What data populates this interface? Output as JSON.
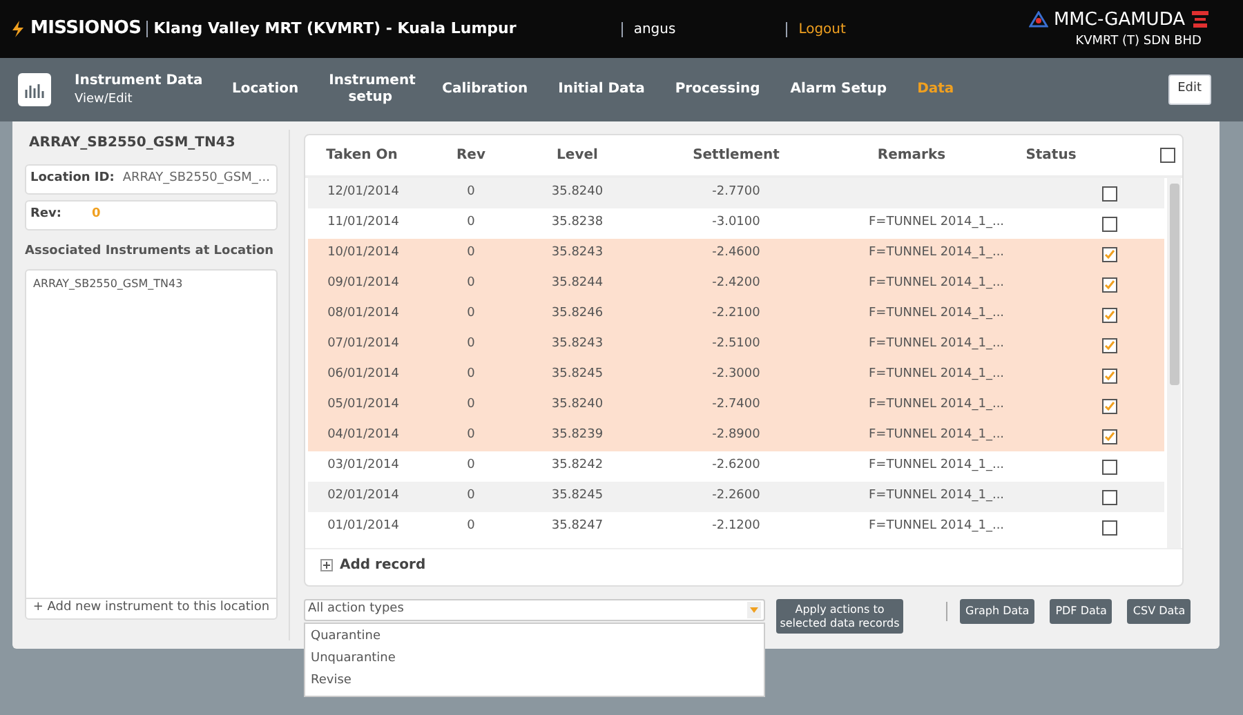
{
  "header": {
    "brand": "MISSIONOS",
    "project": "Klang Valley MRT (KVMRT) - Kuala Lumpur",
    "user": "angus",
    "logout": "Logout",
    "company": "MMC-GAMUDA",
    "company_sub": "KVMRT (T) SDN BHD"
  },
  "nav": {
    "title": "Instrument Data",
    "subtitle": "View/Edit",
    "tabs": [
      {
        "label": "Location",
        "selected": false
      },
      {
        "label": "Instrument setup",
        "selected": false
      },
      {
        "label": "Calibration",
        "selected": false
      },
      {
        "label": "Initial Data",
        "selected": false
      },
      {
        "label": "Processing",
        "selected": false
      },
      {
        "label": "Alarm Setup",
        "selected": false
      },
      {
        "label": "Data",
        "selected": true
      }
    ],
    "edit_button": "Edit"
  },
  "sidebar": {
    "title": "ARRAY_SB2550_GSM_TN43",
    "location_label": "Location ID:",
    "location_value": "ARRAY_SB2550_GSM_...",
    "rev_label": "Rev:",
    "rev_value": "0",
    "instruments_heading": "Associated Instruments at Location",
    "instruments": [
      "ARRAY_SB2550_GSM_TN43"
    ],
    "add_instrument": "+ Add new instrument to this location"
  },
  "table": {
    "columns": [
      "Taken On",
      "Rev",
      "Level",
      "Settlement",
      "Remarks",
      "Status"
    ],
    "all_checked": false,
    "rows": [
      {
        "taken_on": "12/01/2014",
        "rev": "0",
        "level": "35.8240",
        "settlement": "-2.7700",
        "remarks": "",
        "selected": false
      },
      {
        "taken_on": "11/01/2014",
        "rev": "0",
        "level": "35.8238",
        "settlement": "-3.0100",
        "remarks": "F=TUNNEL 2014_1_...",
        "selected": false
      },
      {
        "taken_on": "10/01/2014",
        "rev": "0",
        "level": "35.8243",
        "settlement": "-2.4600",
        "remarks": "F=TUNNEL 2014_1_...",
        "selected": true
      },
      {
        "taken_on": "09/01/2014",
        "rev": "0",
        "level": "35.8244",
        "settlement": "-2.4200",
        "remarks": "F=TUNNEL 2014_1_...",
        "selected": true
      },
      {
        "taken_on": "08/01/2014",
        "rev": "0",
        "level": "35.8246",
        "settlement": "-2.2100",
        "remarks": "F=TUNNEL 2014_1_...",
        "selected": true
      },
      {
        "taken_on": "07/01/2014",
        "rev": "0",
        "level": "35.8243",
        "settlement": "-2.5100",
        "remarks": "F=TUNNEL 2014_1_...",
        "selected": true
      },
      {
        "taken_on": "06/01/2014",
        "rev": "0",
        "level": "35.8245",
        "settlement": "-2.3000",
        "remarks": "F=TUNNEL 2014_1_...",
        "selected": true
      },
      {
        "taken_on": "05/01/2014",
        "rev": "0",
        "level": "35.8240",
        "settlement": "-2.7400",
        "remarks": "F=TUNNEL 2014_1_...",
        "selected": true
      },
      {
        "taken_on": "04/01/2014",
        "rev": "0",
        "level": "35.8239",
        "settlement": "-2.8900",
        "remarks": "F=TUNNEL 2014_1_...",
        "selected": true
      },
      {
        "taken_on": "03/01/2014",
        "rev": "0",
        "level": "35.8242",
        "settlement": "-2.6200",
        "remarks": "F=TUNNEL 2014_1_...",
        "selected": false
      },
      {
        "taken_on": "02/01/2014",
        "rev": "0",
        "level": "35.8245",
        "settlement": "-2.2600",
        "remarks": "F=TUNNEL 2014_1_...",
        "selected": false
      },
      {
        "taken_on": "01/01/2014",
        "rev": "0",
        "level": "35.8247",
        "settlement": "-2.1200",
        "remarks": "F=TUNNEL 2014_1_...",
        "selected": false
      }
    ],
    "add_record": "Add record"
  },
  "actions": {
    "select_value": "All action types",
    "options": [
      "Quarantine",
      "Unquarantine",
      "Revise"
    ],
    "apply_button": "Apply actions to selected data records",
    "export_buttons": [
      "Graph Data",
      "PDF Data",
      "CSV Data"
    ]
  }
}
